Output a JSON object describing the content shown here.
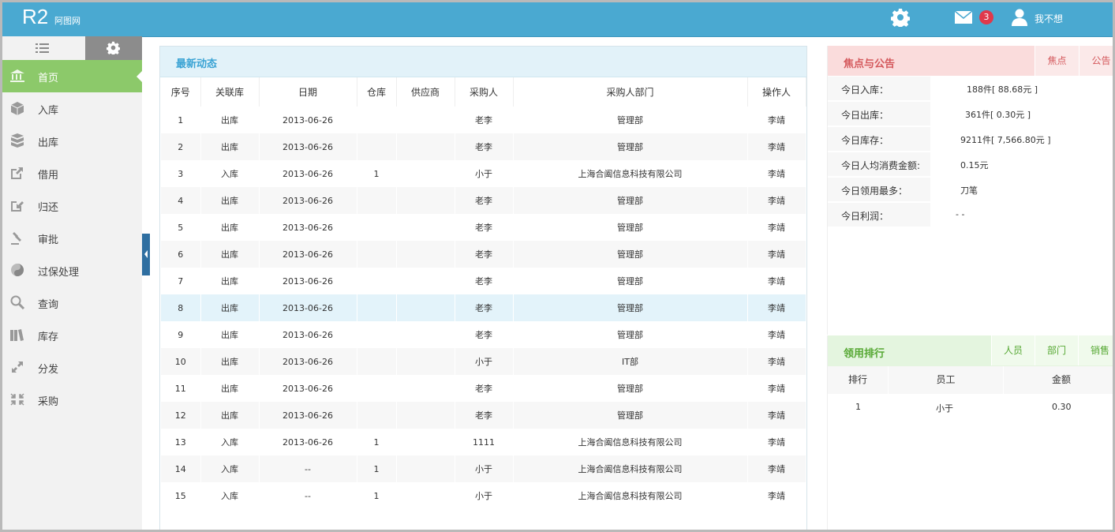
{
  "header": {
    "logo": "R2",
    "logo_sub": "阿图网",
    "mail_count": "3",
    "user_name": "我不想"
  },
  "sidebar": {
    "items": [
      {
        "label": "首页",
        "icon": "bank-icon",
        "active": true
      },
      {
        "label": "入库",
        "icon": "box-icon"
      },
      {
        "label": "出库",
        "icon": "boxes-icon"
      },
      {
        "label": "借用",
        "icon": "external-link-icon"
      },
      {
        "label": "归还",
        "icon": "return-icon"
      },
      {
        "label": "审批",
        "icon": "gavel-icon"
      },
      {
        "label": "过保处理",
        "icon": "yin-yang-icon"
      },
      {
        "label": "查询",
        "icon": "search-icon"
      },
      {
        "label": "库存",
        "icon": "books-icon"
      },
      {
        "label": "分发",
        "icon": "expand-icon"
      },
      {
        "label": "采购",
        "icon": "compress-icon"
      }
    ]
  },
  "main": {
    "title": "最新动态",
    "columns": [
      "序号",
      "关联库",
      "日期",
      "仓库",
      "供应商",
      "采购人",
      "采购人部门",
      "操作人"
    ],
    "rows": [
      [
        "1",
        "出库",
        "2013-06-26",
        "",
        "",
        "老李",
        "管理部",
        "李靖"
      ],
      [
        "2",
        "出库",
        "2013-06-26",
        "",
        "",
        "老李",
        "管理部",
        "李靖"
      ],
      [
        "3",
        "入库",
        "2013-06-26",
        "1",
        "",
        "小于",
        "上海合阖信息科技有限公司",
        "李靖"
      ],
      [
        "4",
        "出库",
        "2013-06-26",
        "",
        "",
        "老李",
        "管理部",
        "李靖"
      ],
      [
        "5",
        "出库",
        "2013-06-26",
        "",
        "",
        "老李",
        "管理部",
        "李靖"
      ],
      [
        "6",
        "出库",
        "2013-06-26",
        "",
        "",
        "老李",
        "管理部",
        "李靖"
      ],
      [
        "7",
        "出库",
        "2013-06-26",
        "",
        "",
        "老李",
        "管理部",
        "李靖"
      ],
      [
        "8",
        "出库",
        "2013-06-26",
        "",
        "",
        "老李",
        "管理部",
        "李靖"
      ],
      [
        "9",
        "出库",
        "2013-06-26",
        "",
        "",
        "老李",
        "管理部",
        "李靖"
      ],
      [
        "10",
        "出库",
        "2013-06-26",
        "",
        "",
        "小于",
        "IT部",
        "李靖"
      ],
      [
        "11",
        "出库",
        "2013-06-26",
        "",
        "",
        "老李",
        "管理部",
        "李靖"
      ],
      [
        "12",
        "出库",
        "2013-06-26",
        "",
        "",
        "老李",
        "管理部",
        "李靖"
      ],
      [
        "13",
        "入库",
        "2013-06-26",
        "1",
        "",
        "1111",
        "上海合阖信息科技有限公司",
        "李靖"
      ],
      [
        "14",
        "入库",
        "--",
        "1",
        "",
        "小于",
        "上海合阖信息科技有限公司",
        "李靖"
      ],
      [
        "15",
        "入库",
        "--",
        "1",
        "",
        "小于",
        "上海合阖信息科技有限公司",
        "李靖"
      ]
    ],
    "highlighted_row": 8
  },
  "focus": {
    "title": "焦点与公告",
    "tabs": [
      "焦点",
      "公告"
    ],
    "stats": [
      {
        "label": "今日入库：",
        "value": "188件[ 88.68元 ]"
      },
      {
        "label": "今日出库：",
        "value": "361件[ 0.30元 ]"
      },
      {
        "label": "今日库存：",
        "value": "9211件[ 7,566.80元 ]"
      },
      {
        "label": "今日人均消费金额:",
        "value": "0.15元"
      },
      {
        "label": "今日领用最多：",
        "value": "刀笔"
      },
      {
        "label": "今日利润：",
        "value": "- -"
      }
    ]
  },
  "rank": {
    "title": "领用排行",
    "tabs": [
      "人员",
      "部门",
      "销售"
    ],
    "columns": [
      "排行",
      "员工",
      "金额"
    ],
    "rows": [
      [
        "1",
        "小于",
        "0.30"
      ]
    ]
  },
  "colors": {
    "header": "#4aa9d1",
    "active_nav": "#8cc96a",
    "focus": "#d4585c",
    "rank": "#56a833"
  }
}
